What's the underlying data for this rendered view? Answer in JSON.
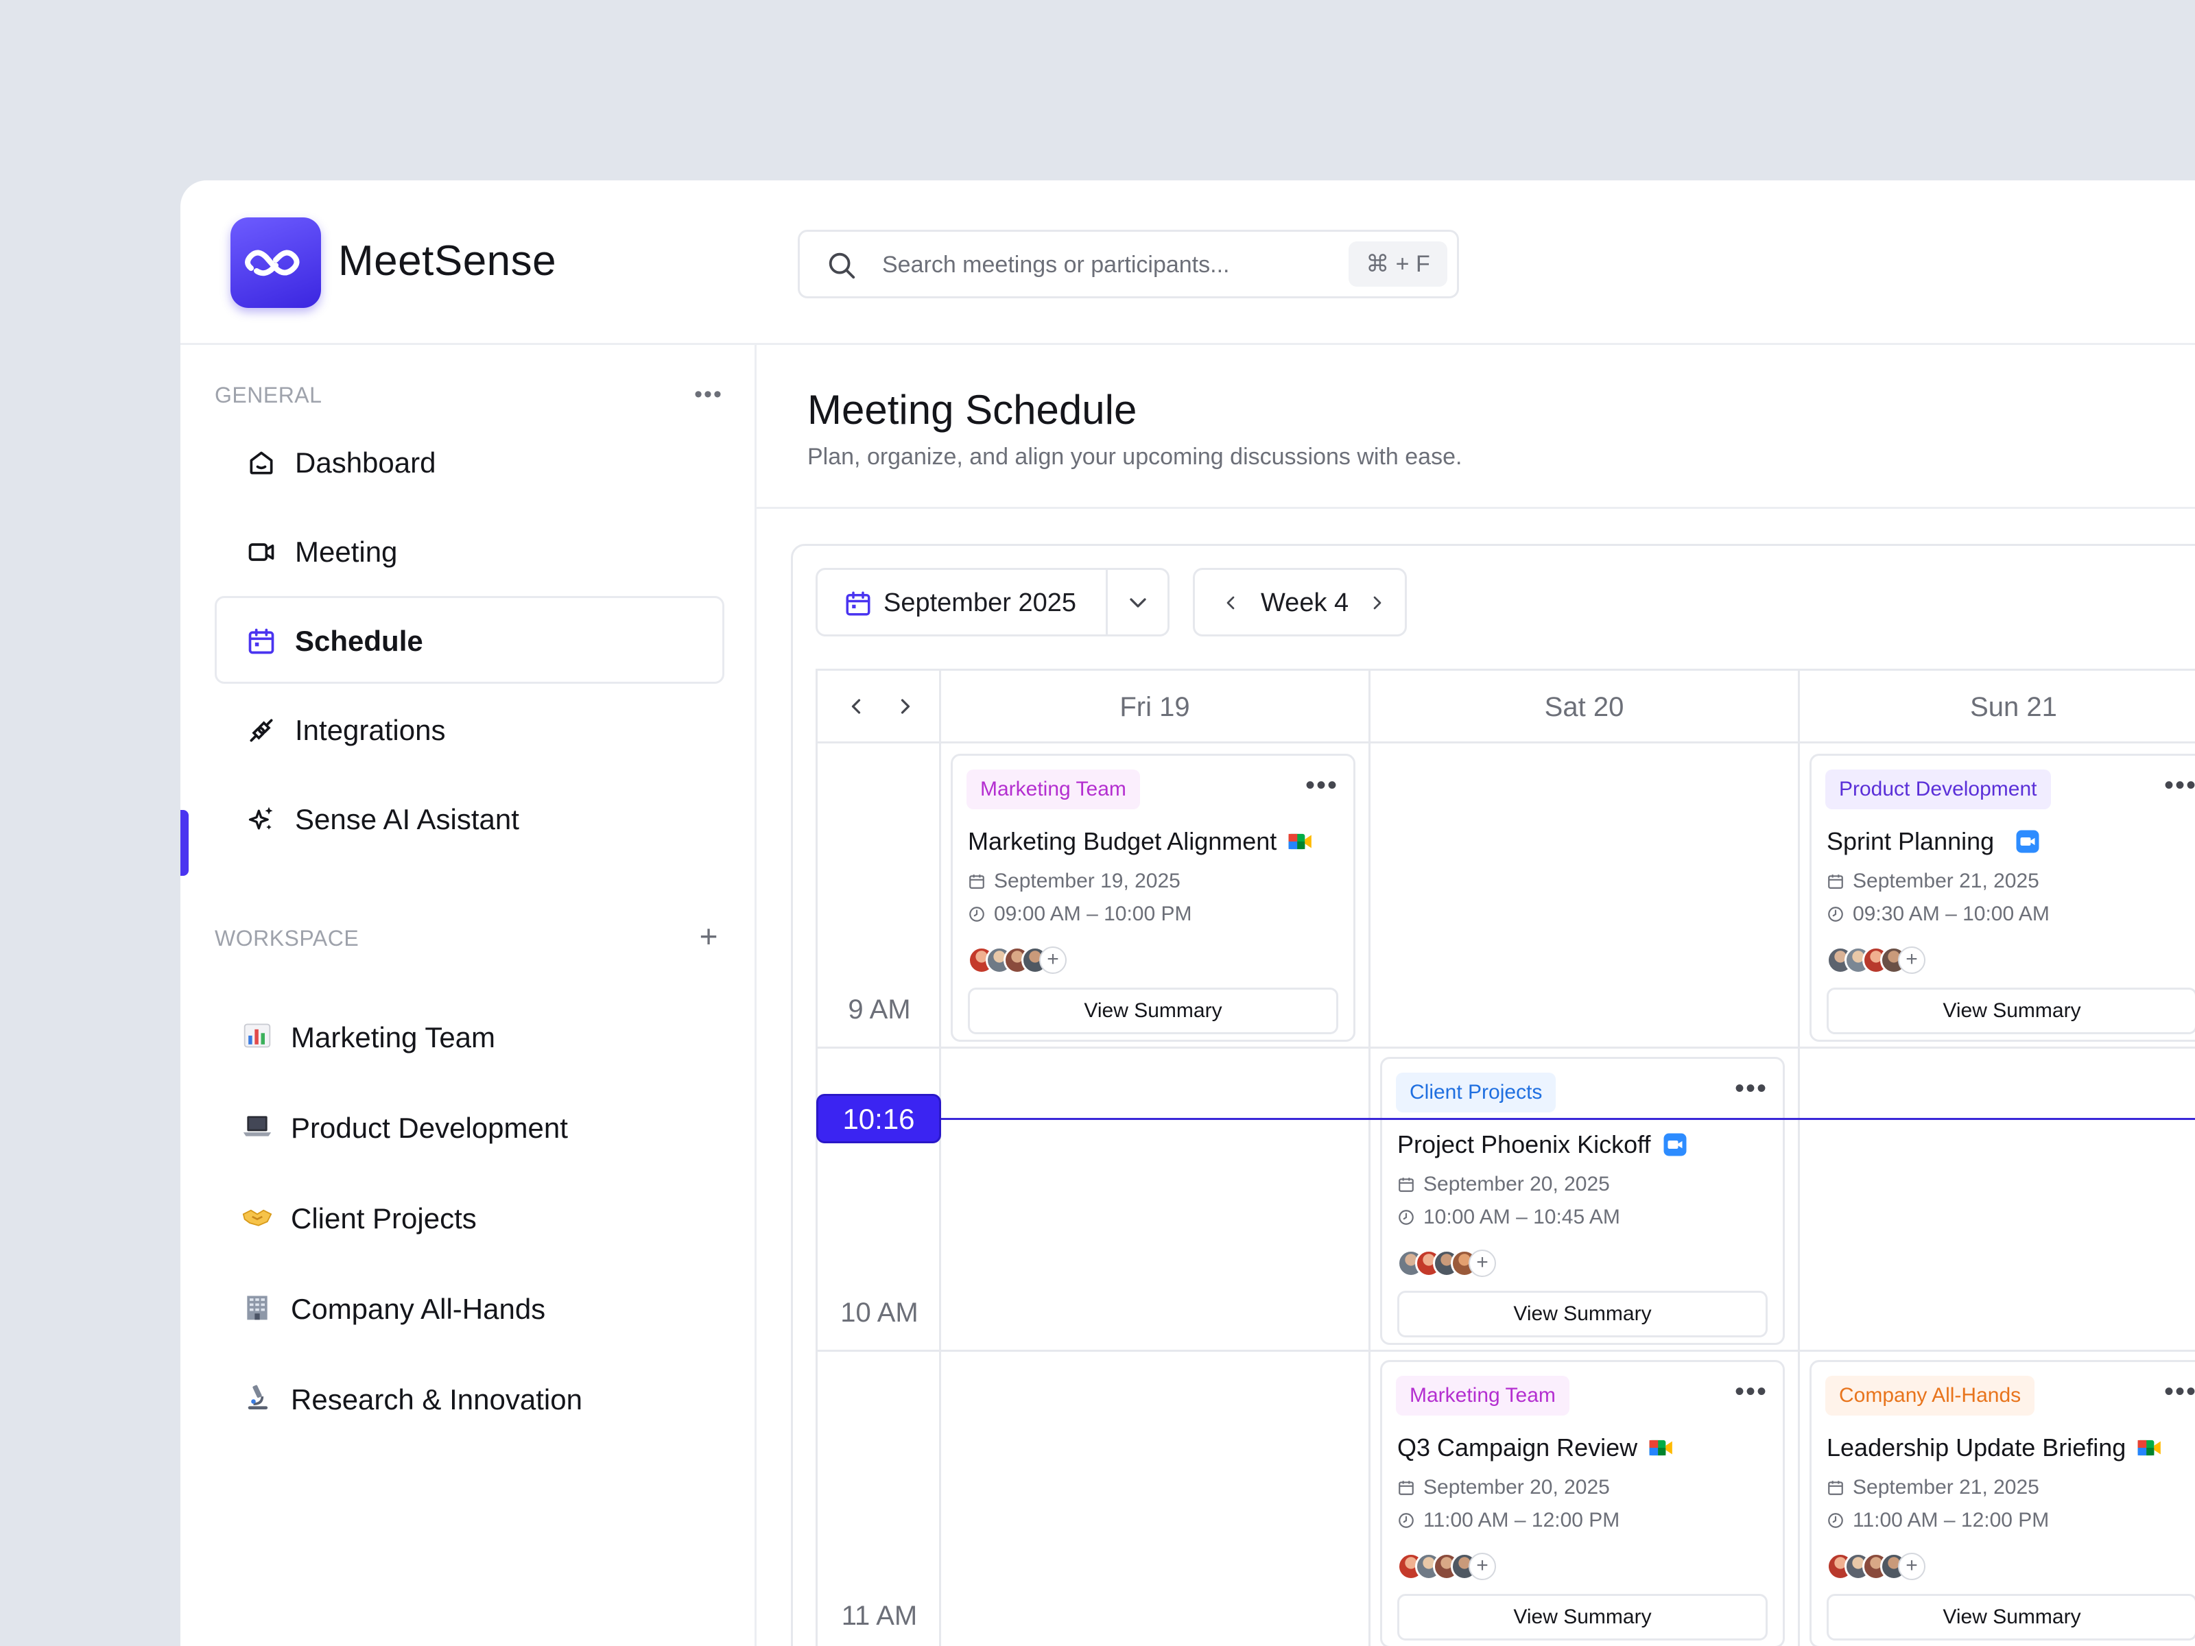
{
  "app": {
    "name": "MeetSense",
    "logo_icon": "infinity-logo-icon",
    "accent": "#4a34f0"
  },
  "search": {
    "placeholder": "Search meetings or participants...",
    "shortcut": "⌘ + F"
  },
  "sidebar": {
    "general_label": "GENERAL",
    "general_action": "•••",
    "nav": [
      {
        "label": "Dashboard",
        "icon": "home-icon"
      },
      {
        "label": "Meeting",
        "icon": "video-icon"
      },
      {
        "label": "Schedule",
        "icon": "calendar-icon",
        "active": true
      },
      {
        "label": "Integrations",
        "icon": "plug-icon"
      },
      {
        "label": "Sense AI Asistant",
        "icon": "sparkles-icon"
      }
    ],
    "workspace_label": "WORKSPACE",
    "workspace_action": "+",
    "workspaces": [
      {
        "label": "Marketing Team",
        "icon": "bar-chart-emoji"
      },
      {
        "label": "Product Development",
        "icon": "laptop-emoji"
      },
      {
        "label": "Client Projects",
        "icon": "handshake-emoji"
      },
      {
        "label": "Company All-Hands",
        "icon": "office-building-emoji"
      },
      {
        "label": "Research & Innovation",
        "icon": "microscope-emoji"
      }
    ]
  },
  "main": {
    "title": "Meeting Schedule",
    "subtitle": "Plan, organize, and align your upcoming discussions with ease."
  },
  "calendar": {
    "month": "September 2025",
    "week": "Week 4",
    "days": [
      "Fri 19",
      "Sat 20",
      "Sun 21"
    ],
    "time_slots": [
      "9 AM",
      "10 AM",
      "11 AM"
    ],
    "now": "10:16",
    "events": [
      {
        "tag": "Marketing Team",
        "tag_color": "#b42fd0",
        "tag_bg": "#fbeffd",
        "title": "Marketing Budget Alignment",
        "app": "google-meet",
        "date": "September 19, 2025",
        "time": "09:00 AM – 10:00 PM",
        "more": "+",
        "button": "View Summary",
        "menu": "•••"
      },
      {
        "tag": "Product Development",
        "tag_color": "#5a2fd8",
        "tag_bg": "#f1edff",
        "title": "Sprint Planning",
        "app": "zoom",
        "date": "September 21, 2025",
        "time": "09:30 AM – 10:00 AM",
        "more": "+",
        "button": "View Summary",
        "menu": "•••"
      },
      {
        "tag": "Client Projects",
        "tag_color": "#1f6fe0",
        "tag_bg": "#ecf4ff",
        "title": "Project Phoenix Kickoff",
        "app": "zoom",
        "date": "September 20, 2025",
        "time": "10:00 AM – 10:45 AM",
        "more": "+",
        "button": "View Summary",
        "menu": "•••"
      },
      {
        "tag": "Marketing Team",
        "tag_color": "#b42fd0",
        "tag_bg": "#fbeffd",
        "title": "Q3 Campaign Review",
        "app": "google-meet",
        "date": "September 20, 2025",
        "time": "11:00 AM – 12:00 PM",
        "more": "+",
        "button": "View Summary",
        "menu": "•••"
      },
      {
        "tag": "Company All-Hands",
        "tag_color": "#e8741c",
        "tag_bg": "#fff3ea",
        "title": "Leadership Update Briefing",
        "app": "google-meet",
        "date": "September 21, 2025",
        "time": "11:00 AM – 12:00 PM",
        "more": "+",
        "button": "View Summary",
        "menu": "•••"
      }
    ]
  }
}
